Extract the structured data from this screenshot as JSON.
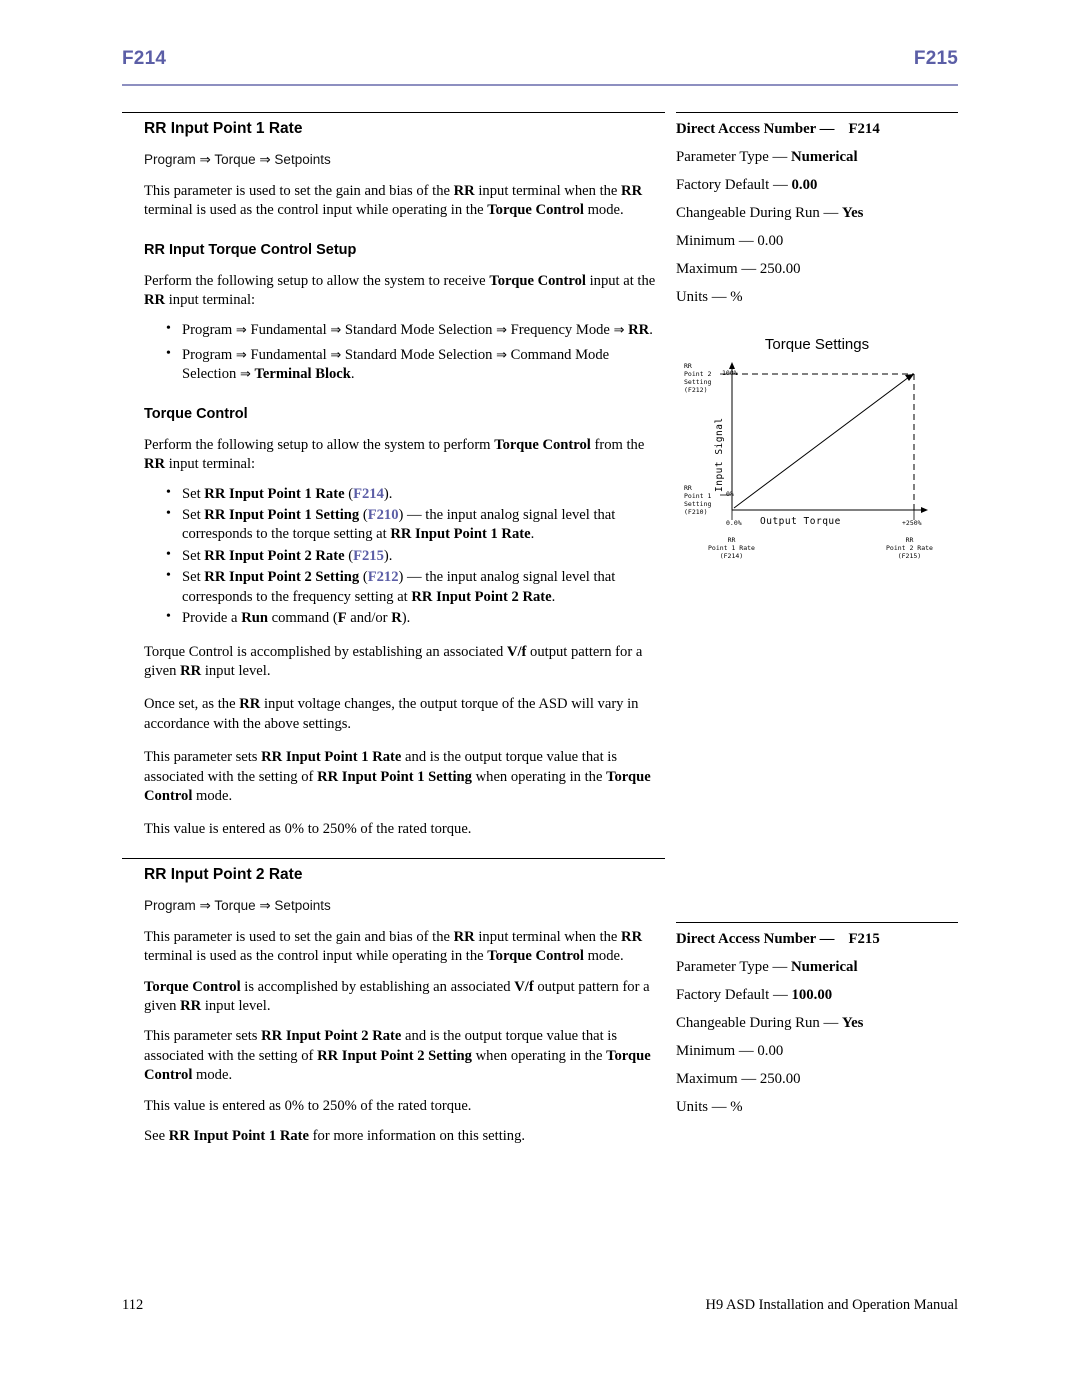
{
  "header": {
    "left_code": "F214",
    "right_code": "F215"
  },
  "section1": {
    "title": "RR Input Point 1 Rate",
    "path": "Program ⇒ Torque ⇒ Setpoints",
    "intro_1": "This parameter is used to set the gain and bias of the ",
    "intro_rr": "RR",
    "intro_2": " input terminal when the ",
    "intro_3": " terminal is used as the control input while operating in the ",
    "intro_torque_control": "Torque Control",
    "intro_4": " mode.",
    "setup_head": "RR Input Torque Control Setup",
    "setup_p1": "Perform the following setup to allow the system to receive ",
    "setup_p1_b": "Torque Control",
    "setup_p1_c": " input at the ",
    "setup_p1_d": " input terminal:",
    "bullets": [
      {
        "text_a": "Program ⇒ Fundamental ⇒ Standard Mode Selection ⇒ Frequency Mode ⇒ ",
        "bold_b": "RR",
        "text_c": "."
      },
      {
        "text_a": "Program ⇒ Fundamental ⇒ Standard Mode Selection ⇒ Command Mode Selection ⇒ ",
        "bold_b": "Terminal Block",
        "text_c": "."
      }
    ],
    "torque_head": "Torque Control",
    "torque_p1_a": "Perform the following setup to allow the system to perform ",
    "torque_p1_b": "Torque Control",
    "torque_p1_c": " from the ",
    "torque_p1_d": " input terminal:",
    "torque_bullets": [
      {
        "pre": "Set ",
        "bold": "RR Input Point 1 Rate",
        "paren_open": " (",
        "ref": "F214",
        "paren_close": ")."
      },
      {
        "pre": "Set ",
        "bold": "RR Input Point 1 Setting",
        "paren_open": " (",
        "ref": "F210",
        "paren_close": ") — the input analog signal level that corresponds to the torque setting at ",
        "bold2": "RR Input Point 1 Rate",
        "tail": "."
      },
      {
        "pre": "Set ",
        "bold": "RR Input Point 2 Rate",
        "paren_open": " (",
        "ref": "F215",
        "paren_close": ")."
      },
      {
        "pre": "Set ",
        "bold": "RR Input Point 2 Setting",
        "paren_open": " (",
        "ref": "F212",
        "paren_close": ") — the input analog signal level that corresponds to the frequency setting at ",
        "bold2": "RR Input Point 2 Rate",
        "tail": "."
      },
      {
        "pre": "Provide a ",
        "bold": "Run",
        "paren_open": " command (",
        "ref": "",
        "paren_close": ""
      }
    ],
    "run_bullet_text": "Provide a Run command (F and/or R).",
    "para_vf_a": "Torque Control is accomplished by establishing an associated ",
    "para_vf_b": "V/f",
    "para_vf_c": " output pattern for a given ",
    "para_vf_d": " input level.",
    "para_once_a": "Once set, as the ",
    "para_once_b": " input voltage changes, the output torque of the ASD will vary in accordance with the above settings.",
    "para_sets_a": "This parameter sets ",
    "para_sets_b": "RR Input Point 1 Rate",
    "para_sets_c": " and is the output torque value that is associated with the setting of ",
    "para_sets_d": "RR Input Point 1 Setting",
    "para_sets_e": " when operating in the ",
    "para_sets_f": "Torque Control",
    "para_sets_g": " mode.",
    "para_value": "This value is entered as 0% to 250% of the rated torque."
  },
  "spec1": {
    "dan_label": "Direct Access Number —",
    "dan_value": "F214",
    "rows": [
      {
        "label": "Parameter Type — ",
        "value": "Numerical",
        "bold": true
      },
      {
        "label": "Factory Default — ",
        "value": "0.00",
        "bold": true
      },
      {
        "label": "Changeable During Run — ",
        "value": "Yes",
        "bold": true
      },
      {
        "label": "Minimum — ",
        "value": "0.00",
        "bold": false
      },
      {
        "label": "Maximum — ",
        "value": "250.00",
        "bold": false
      },
      {
        "label": "Units — ",
        "value": "%",
        "bold": false
      }
    ]
  },
  "diagram": {
    "title": "Torque Settings",
    "top_left_label": "RR\nPoint 2\nSetting\n(F212)",
    "top_left_value": "100%",
    "bottom_left_label": "RR\nPoint 1\nSetting\n(F210)",
    "bottom_left_value": "0%",
    "x_min": "0.0%",
    "x_max": "+250%",
    "x_axis": "Output Torque",
    "y_axis": "Input Signal",
    "bottom_left_caption": "RR\nPoint 1 Rate\n(F214)",
    "bottom_right_caption": "RR\nPoint 2 Rate\n(F215)"
  },
  "section2": {
    "title": "RR Input Point 2 Rate",
    "path": "Program ⇒ Torque ⇒ Setpoints",
    "para_vf_a": "Torque Control",
    "para_vf_b": " is accomplished by establishing an associated ",
    "para_vf_c": "V/f",
    "para_vf_d": " output pattern for a given ",
    "para_vf_e": " input level.",
    "para_sets_b": "RR Input Point 2 Rate",
    "para_sets_d": "RR Input Point 2 Setting",
    "para_see_a": "See ",
    "para_see_b": "RR Input Point 1 Rate",
    "para_see_c": " for more information on this setting."
  },
  "spec2": {
    "dan_label": "Direct Access Number —",
    "dan_value": "F215",
    "rows": [
      {
        "label": "Parameter Type — ",
        "value": "Numerical",
        "bold": true
      },
      {
        "label": "Factory Default — ",
        "value": "100.00",
        "bold": true
      },
      {
        "label": "Changeable During Run — ",
        "value": "Yes",
        "bold": true
      },
      {
        "label": "Minimum — ",
        "value": "0.00",
        "bold": false
      },
      {
        "label": "Maximum — ",
        "value": "250.00",
        "bold": false
      },
      {
        "label": "Units — ",
        "value": "%",
        "bold": false
      }
    ]
  },
  "footer": {
    "page_number": "112",
    "manual_title": "H9 ASD Installation and Operation Manual"
  }
}
